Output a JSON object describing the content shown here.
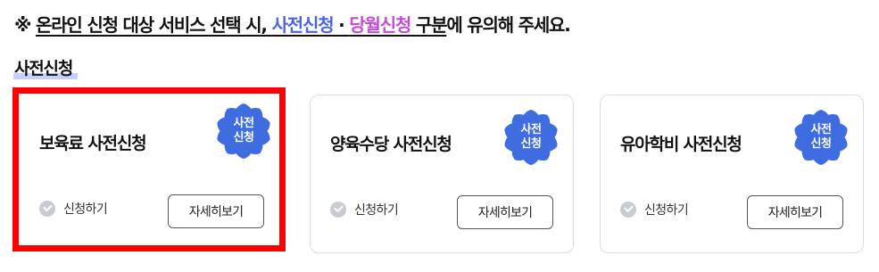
{
  "notice": {
    "prefix": "※ ",
    "part1": "온라인 신청 대상 서비스 선택 시,",
    "pre": "사전신청",
    "dot": " · ",
    "cur": "당월신청",
    "part2": " 구분",
    "part3": "에 유의해 주세요."
  },
  "section_title": "사전신청",
  "badge_lines": [
    "사전",
    "신청"
  ],
  "cards": [
    {
      "title": "보육료 사전신청",
      "apply_label": "신청하기",
      "detail_label": "자세히보기"
    },
    {
      "title": "양육수당 사전신청",
      "apply_label": "신청하기",
      "detail_label": "자세히보기"
    },
    {
      "title": "유아학비 사전신청",
      "apply_label": "신청하기",
      "detail_label": "자세히보기"
    }
  ],
  "colors": {
    "accent_blue": "#4a63e7",
    "accent_purple": "#c64bd6",
    "badge_blue": "#3f6de0",
    "selection_red": "#ff0000"
  }
}
